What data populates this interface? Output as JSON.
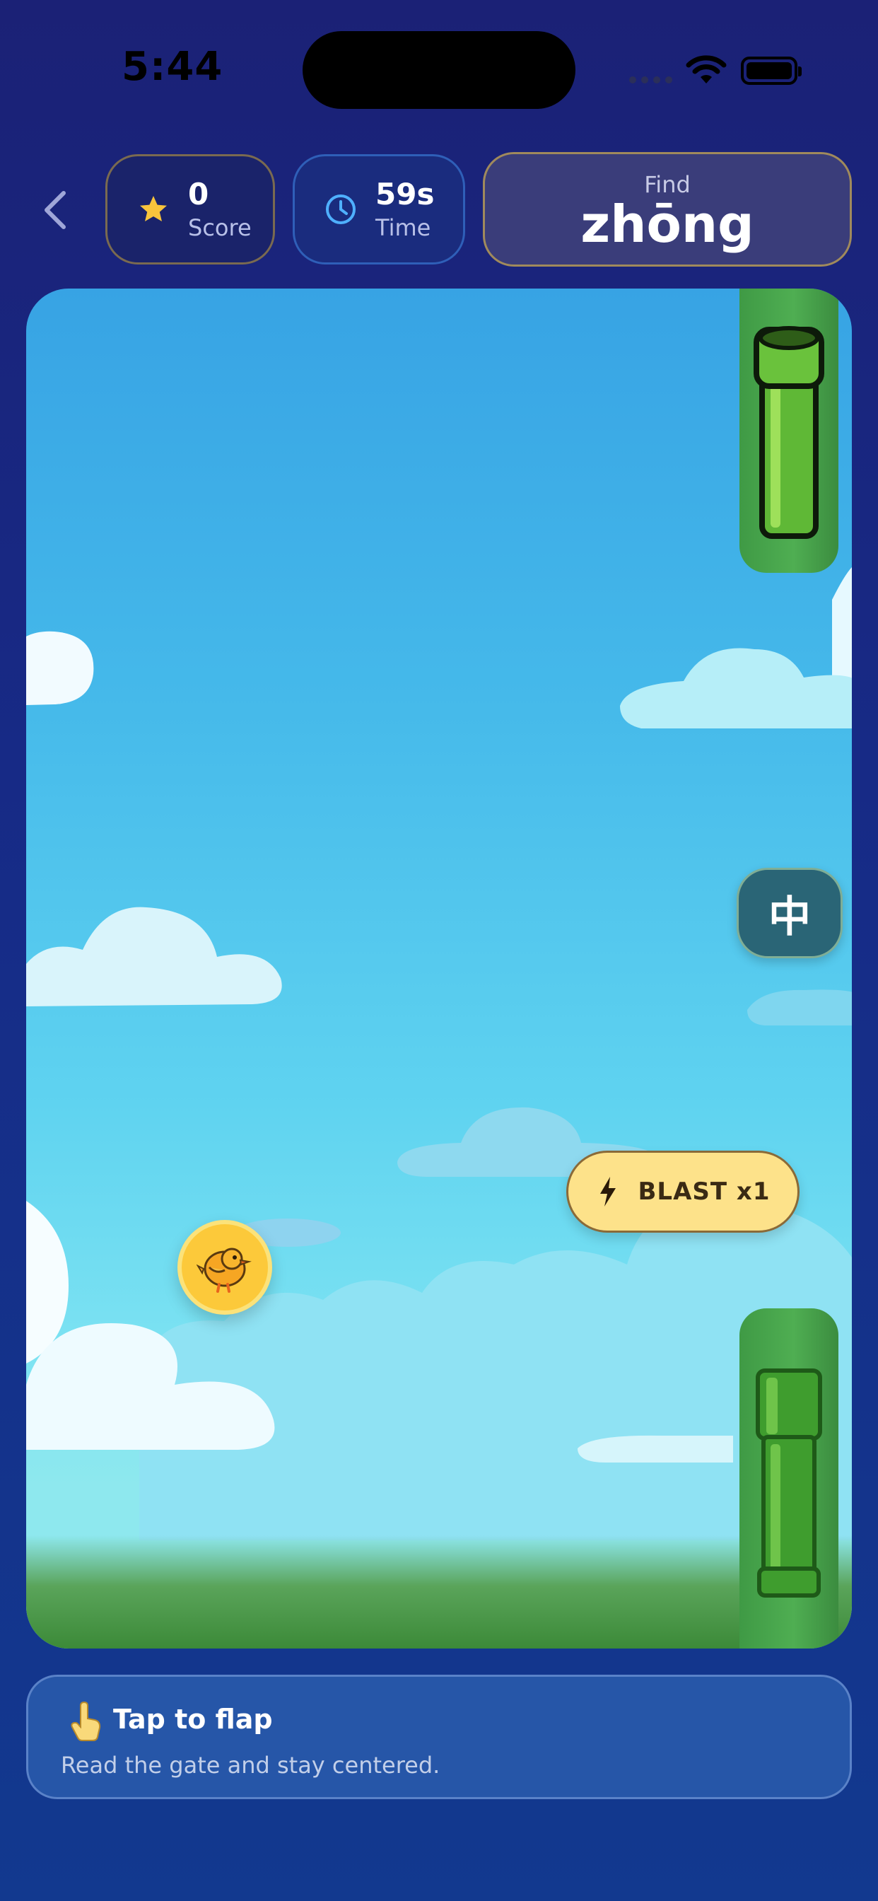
{
  "status_bar": {
    "time": "5:44"
  },
  "header": {
    "back_icon": "chevron-left-icon",
    "score": {
      "value": "0",
      "label": "Score",
      "icon": "star-icon"
    },
    "time": {
      "value": "59s",
      "label": "Time",
      "icon": "clock-icon"
    },
    "find": {
      "label": "Find",
      "target": "zhōng"
    }
  },
  "game": {
    "gate_character": "中",
    "blast_button": {
      "label": "BLAST x1",
      "icon": "lightning-icon"
    },
    "player_icon": "bird-icon"
  },
  "hint": {
    "icon": "tap-hand-icon",
    "title": "Tap to flap",
    "subtitle": "Read the gate and stay centered."
  },
  "colors": {
    "background": "#1b2176",
    "sky": "#45b9ea",
    "pipe": "#4fae52",
    "accent_yellow": "#fde28a",
    "gate": "#2a6576"
  }
}
